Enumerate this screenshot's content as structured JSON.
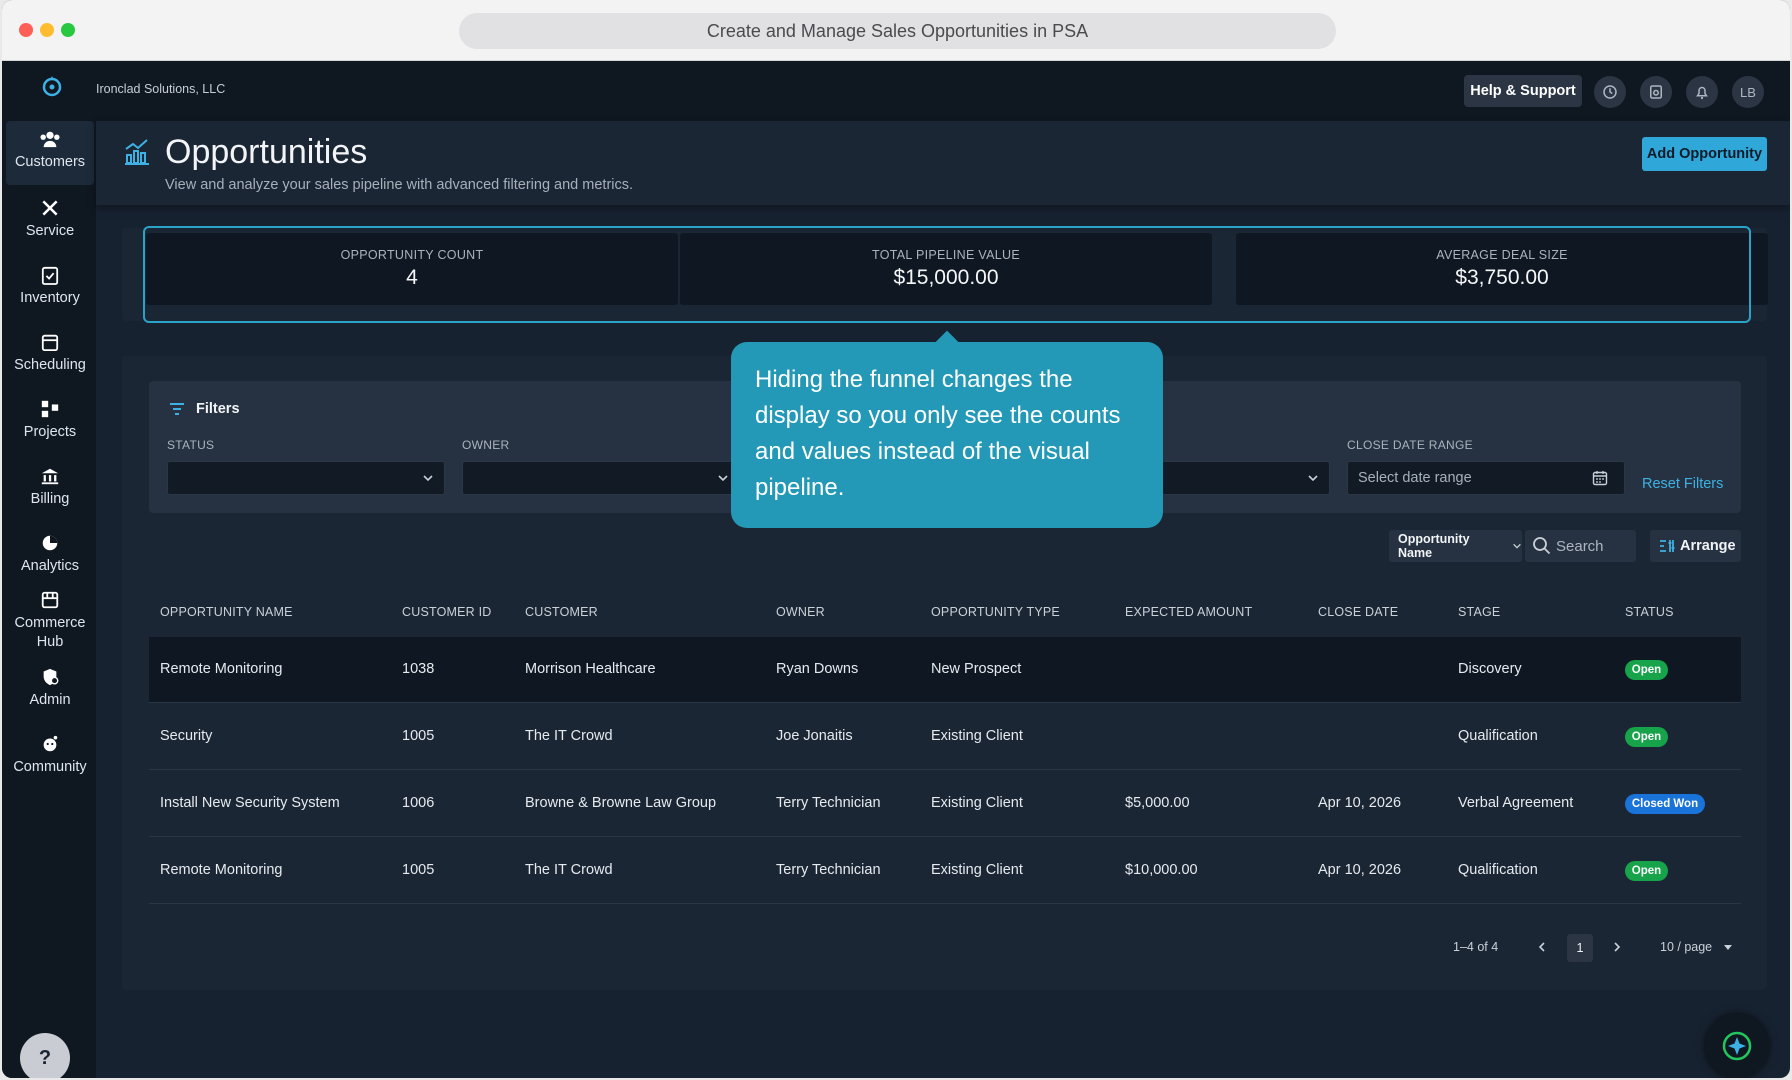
{
  "window": {
    "title": "Create and Manage Sales Opportunities in PSA"
  },
  "topnav": {
    "company": "Ironclad Solutions, LLC",
    "help_label": "Help & Support",
    "avatar": "LB",
    "icons": [
      "history-icon",
      "timer-icon",
      "bell-icon"
    ]
  },
  "sidebar": {
    "items": [
      {
        "label": "Customers",
        "icon": "users-icon",
        "active": true
      },
      {
        "label": "Service",
        "icon": "tools-icon"
      },
      {
        "label": "Inventory",
        "icon": "clipboard-icon"
      },
      {
        "label": "Scheduling",
        "icon": "calendar-icon"
      },
      {
        "label": "Projects",
        "icon": "projects-icon"
      },
      {
        "label": "Billing",
        "icon": "bank-icon"
      },
      {
        "label": "Analytics",
        "icon": "pie-chart-icon"
      },
      {
        "label": "Commerce Hub",
        "icon": "store-icon"
      },
      {
        "label": "Admin",
        "icon": "admin-icon"
      },
      {
        "label": "Community",
        "icon": "community-icon"
      }
    ],
    "help_label": "?"
  },
  "header": {
    "title": "Opportunities",
    "subtitle": "View and analyze your sales pipeline with advanced filtering and metrics.",
    "add_button": "Add Opportunity"
  },
  "metrics": [
    {
      "label": "OPPORTUNITY COUNT",
      "value": "4"
    },
    {
      "label": "TOTAL PIPELINE VALUE",
      "value": "$15,000.00"
    },
    {
      "label": "AVERAGE DEAL SIZE",
      "value": "$3,750.00"
    }
  ],
  "filters": {
    "title": "Filters",
    "status_label": "STATUS",
    "owner_label": "OWNER",
    "close_date_label": "CLOSE DATE RANGE",
    "date_placeholder": "Select date range",
    "reset": "Reset Filters"
  },
  "tooltip": {
    "text": "Hiding the funnel changes the display so you only see the counts and values instead of the visual pipeline."
  },
  "toolbar": {
    "sort_field": "Opportunity Name",
    "search_placeholder": "Search",
    "arrange": "Arrange"
  },
  "table": {
    "headers": [
      "OPPORTUNITY NAME",
      "CUSTOMER ID",
      "CUSTOMER",
      "OWNER",
      "OPPORTUNITY TYPE",
      "EXPECTED AMOUNT",
      "CLOSE DATE",
      "STAGE",
      "STATUS"
    ],
    "rows": [
      {
        "name": "Remote Monitoring",
        "customer_id": "1038",
        "customer": "Morrison Healthcare",
        "owner": "Ryan Downs",
        "type": "New Prospect",
        "amount": "",
        "close_date": "",
        "stage": "Discovery",
        "status": "Open"
      },
      {
        "name": "Security",
        "customer_id": "1005",
        "customer": "The IT Crowd",
        "owner": "Joe Jonaitis",
        "type": "Existing Client",
        "amount": "",
        "close_date": "",
        "stage": "Qualification",
        "status": "Open"
      },
      {
        "name": "Install New Security System",
        "customer_id": "1006",
        "customer": "Browne & Browne Law Group",
        "owner": "Terry Technician",
        "type": "Existing Client",
        "amount": "$5,000.00",
        "close_date": "Apr 10, 2026",
        "stage": "Verbal Agreement",
        "status": "Closed Won"
      },
      {
        "name": "Remote Monitoring",
        "customer_id": "1005",
        "customer": "The IT Crowd",
        "owner": "Terry Technician",
        "type": "Existing Client",
        "amount": "$10,000.00",
        "close_date": "Apr 10, 2026",
        "stage": "Qualification",
        "status": "Open"
      }
    ]
  },
  "pagination": {
    "range": "1–4 of 4",
    "page": "1",
    "per_page": "10 / page"
  },
  "colors": {
    "accent": "#2fa8d9",
    "open": "#16a34a",
    "closed_won": "#1a73d9",
    "tooltip": "#2399b7"
  }
}
